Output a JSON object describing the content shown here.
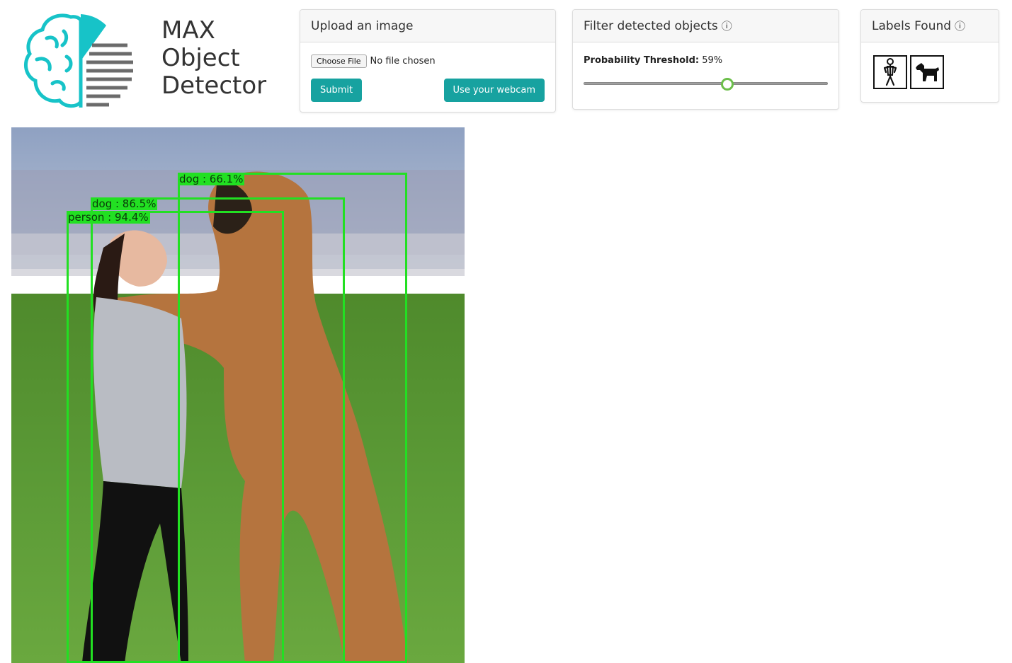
{
  "app": {
    "title_lines": [
      "MAX",
      "Object",
      "Detector"
    ]
  },
  "upload": {
    "header": "Upload an image",
    "choose_file_label": "Choose File",
    "file_status": "No file chosen",
    "submit_label": "Submit",
    "webcam_label": "Use your webcam"
  },
  "filter": {
    "header": "Filter detected objects",
    "info_icon": "ⓘ",
    "threshold_label": "Probability Threshold:",
    "threshold_value": "59%",
    "slider_fraction": 0.59
  },
  "labels": {
    "header": "Labels Found",
    "info_icon": "ⓘ",
    "icons": [
      "person-icon",
      "dog-icon"
    ]
  },
  "detections": [
    {
      "label": "dog : 66.1%"
    },
    {
      "label": "dog : 86.5%"
    },
    {
      "label": "person : 94.4%"
    }
  ],
  "colors": {
    "accent": "#17a2a0",
    "logo_teal": "#17c3c8",
    "bbox": "#22e022",
    "slider_thumb": "#6cbf4a"
  }
}
